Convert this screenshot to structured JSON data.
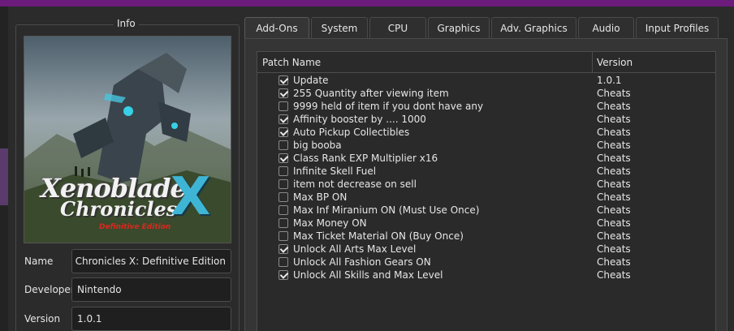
{
  "info": {
    "group_title": "Info",
    "cover": {
      "logo_line1": "Xenoblade",
      "logo_line2": "Chronicles",
      "logo_x": "X",
      "logo_edition": "Definitive Edition"
    },
    "fields": [
      {
        "label": "Name",
        "value": "Xenoblade Chronicles X: Definitive Edition"
      },
      {
        "label": "Developer",
        "value": "Nintendo"
      },
      {
        "label": "Version",
        "value": "1.0.1"
      }
    ]
  },
  "tabs": [
    {
      "label": "Add-Ons",
      "active": true
    },
    {
      "label": "System",
      "active": false
    },
    {
      "label": "CPU",
      "active": false
    },
    {
      "label": "Graphics",
      "active": false
    },
    {
      "label": "Adv. Graphics",
      "active": false
    },
    {
      "label": "Audio",
      "active": false
    },
    {
      "label": "Input Profiles",
      "active": false
    }
  ],
  "table": {
    "headers": {
      "name": "Patch Name",
      "version": "Version"
    },
    "rows": [
      {
        "name": "Update",
        "version": "1.0.1",
        "checked": true
      },
      {
        "name": "255 Quantity after viewing item",
        "version": "Cheats",
        "checked": true
      },
      {
        "name": "9999 held of item if you dont have any",
        "version": "Cheats",
        "checked": false
      },
      {
        "name": "Affinity booster by .... 1000",
        "version": "Cheats",
        "checked": true
      },
      {
        "name": "Auto Pickup Collectibles",
        "version": "Cheats",
        "checked": true
      },
      {
        "name": "big booba",
        "version": "Cheats",
        "checked": false
      },
      {
        "name": "Class Rank EXP Multiplier x16",
        "version": "Cheats",
        "checked": true
      },
      {
        "name": "Infinite Skell Fuel",
        "version": "Cheats",
        "checked": false
      },
      {
        "name": "item not decrease on sell",
        "version": "Cheats",
        "checked": false
      },
      {
        "name": "Max BP ON",
        "version": "Cheats",
        "checked": false
      },
      {
        "name": "Max Inf Miranium ON (Must Use Once)",
        "version": "Cheats",
        "checked": false
      },
      {
        "name": "Max Money ON",
        "version": "Cheats",
        "checked": false
      },
      {
        "name": "Max Ticket Material ON (Buy Once)",
        "version": "Cheats",
        "checked": false
      },
      {
        "name": "Unlock All Arts Max Level",
        "version": "Cheats",
        "checked": true
      },
      {
        "name": "Unlock All Fashion Gears ON",
        "version": "Cheats",
        "checked": false
      },
      {
        "name": "Unlock All Skills and Max Level",
        "version": "Cheats",
        "checked": true
      }
    ]
  },
  "colors": {
    "accent_bar": "#6a1b7c",
    "background": "#2b2b2b",
    "table_bg": "#2a2a2a"
  }
}
